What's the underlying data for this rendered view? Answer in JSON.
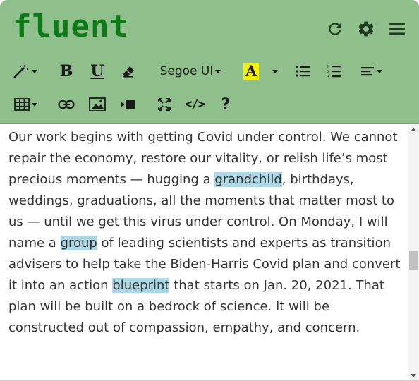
{
  "app": {
    "brand": "fluent"
  },
  "header_actions": [
    "refresh-icon",
    "settings-icon",
    "menu-icon"
  ],
  "toolbar": {
    "font_name": "Segoe UI",
    "highlight_letter": "A",
    "code_label": "</>",
    "help_label": "?"
  },
  "editor": {
    "paragraph": [
      {
        "text": "Our work begins with getting Covid under control. We cannot repair the economy, restore our vitality, or relish life’s most precious moments — hugging a "
      },
      {
        "text": "grandchild",
        "highlight": true
      },
      {
        "text": ", birthdays, weddings, graduations, all the moments that matter most to us — until we get this virus under control. On Monday, I will name a "
      },
      {
        "text": "group",
        "highlight": true
      },
      {
        "text": " of leading scientists and experts as transition advisers to help take the Biden-Harris Covid plan and convert it into an action "
      },
      {
        "text": "blueprint",
        "highlight": true
      },
      {
        "text": " that starts on Jan. 20, 2021. That plan will be built on a bedrock of science. It will be constructed out of compassion, empathy, and concern."
      }
    ]
  },
  "colors": {
    "header_bg": "#8fbf8b",
    "brand": "#0b7a17",
    "highlight": "#add8e6",
    "font_highlight": "#f6f000"
  }
}
